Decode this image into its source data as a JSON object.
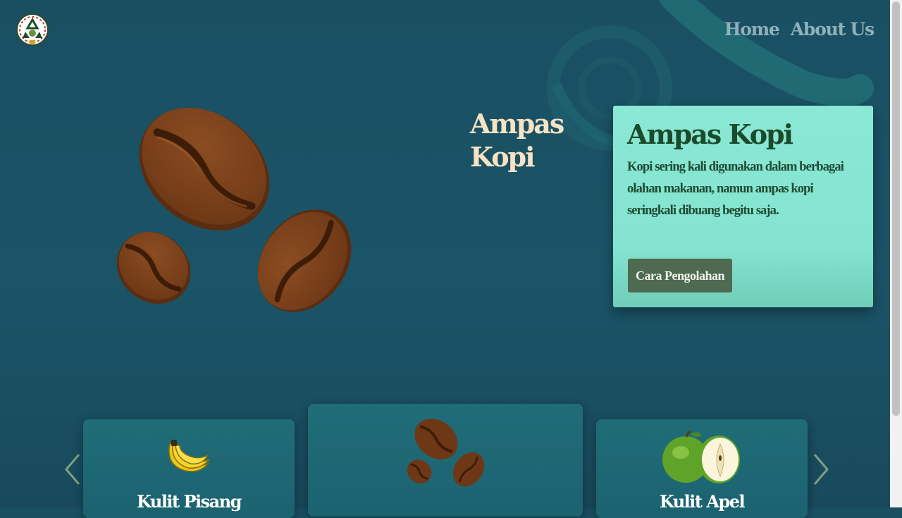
{
  "nav": {
    "items": [
      {
        "label": "Home"
      },
      {
        "label": "About Us"
      }
    ]
  },
  "hero": {
    "title_line1": "Ampas",
    "title_line2": "Kopi",
    "image_icon": "coffee-beans-icon"
  },
  "info_card": {
    "title": "Ampas Kopi",
    "text": "Kopi sering kali digunakan dalam berbagai olahan makanan, namun ampas kopi seringkali dibuang begitu saja.",
    "button_label": "Cara Pengolahan"
  },
  "carousel": {
    "items": [
      {
        "label": "Kulit Pisang",
        "icon": "banana-icon"
      },
      {
        "label": "",
        "icon": "coffee-beans-icon"
      },
      {
        "label": "Kulit Apel",
        "icon": "apple-icon"
      }
    ]
  },
  "colors": {
    "background": "#1b5467",
    "accent_card": "#8ae8d4",
    "button": "#4e6a50",
    "hero_title": "#f7e3c4"
  }
}
